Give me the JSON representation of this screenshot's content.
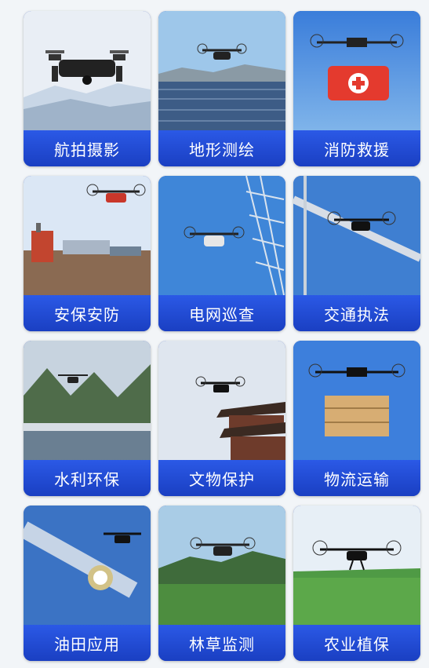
{
  "items": [
    {
      "label": "航拍摄影"
    },
    {
      "label": "地形测绘"
    },
    {
      "label": "消防救援"
    },
    {
      "label": "安保安防"
    },
    {
      "label": "电网巡查"
    },
    {
      "label": "交通执法"
    },
    {
      "label": "水利环保"
    },
    {
      "label": "文物保护"
    },
    {
      "label": "物流运输"
    },
    {
      "label": "油田应用"
    },
    {
      "label": "林草监测"
    },
    {
      "label": "农业植保"
    }
  ],
  "colors": {
    "accent": "#1f46c9",
    "card_label_text": "#ffffff",
    "page_bg": "#f2f5f8"
  }
}
